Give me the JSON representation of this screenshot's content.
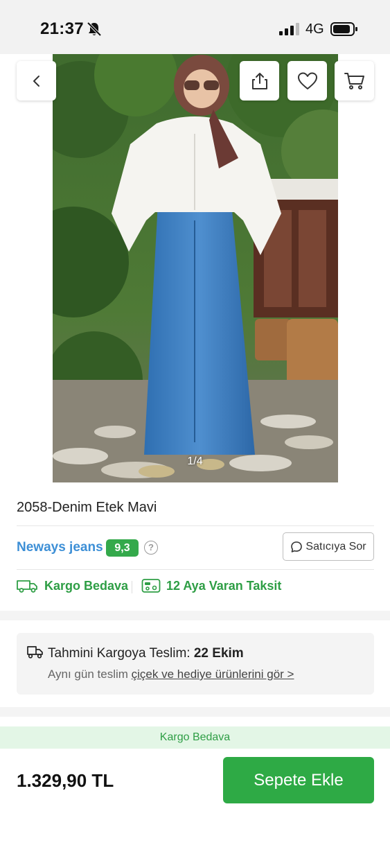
{
  "status_bar": {
    "time": "21:37",
    "network": "4G",
    "icons": [
      "bell-off-icon",
      "signal-icon",
      "battery-icon"
    ]
  },
  "gallery": {
    "counter": "1/4"
  },
  "top_actions": {
    "icons": [
      "chevron-left-icon",
      "share-icon",
      "heart-icon",
      "cart-icon"
    ]
  },
  "product": {
    "title": "2058-Denim Etek Mavi"
  },
  "seller": {
    "name": "Neways jeans",
    "rating": "9,3",
    "help_glyph": "?",
    "ask_label": "Satıcıya Sor"
  },
  "features": {
    "free_shipping": "Kargo Bedava",
    "installments": "12 Aya Varan Taksit"
  },
  "delivery": {
    "label": "Tahmini Kargoya Teslim:",
    "date": "22 Ekim",
    "note": "Aynı gün teslim",
    "link": "çiçek ve hediye ürünlerini gör >"
  },
  "bottom": {
    "banner": "Kargo Bedava",
    "price": "1.329,90 TL",
    "add_to_cart": "Sepete Ekle"
  },
  "colors": {
    "accent_green": "#2eaa45",
    "seller_blue": "#3d8fd6",
    "banner_bg": "#e3f6e6"
  }
}
